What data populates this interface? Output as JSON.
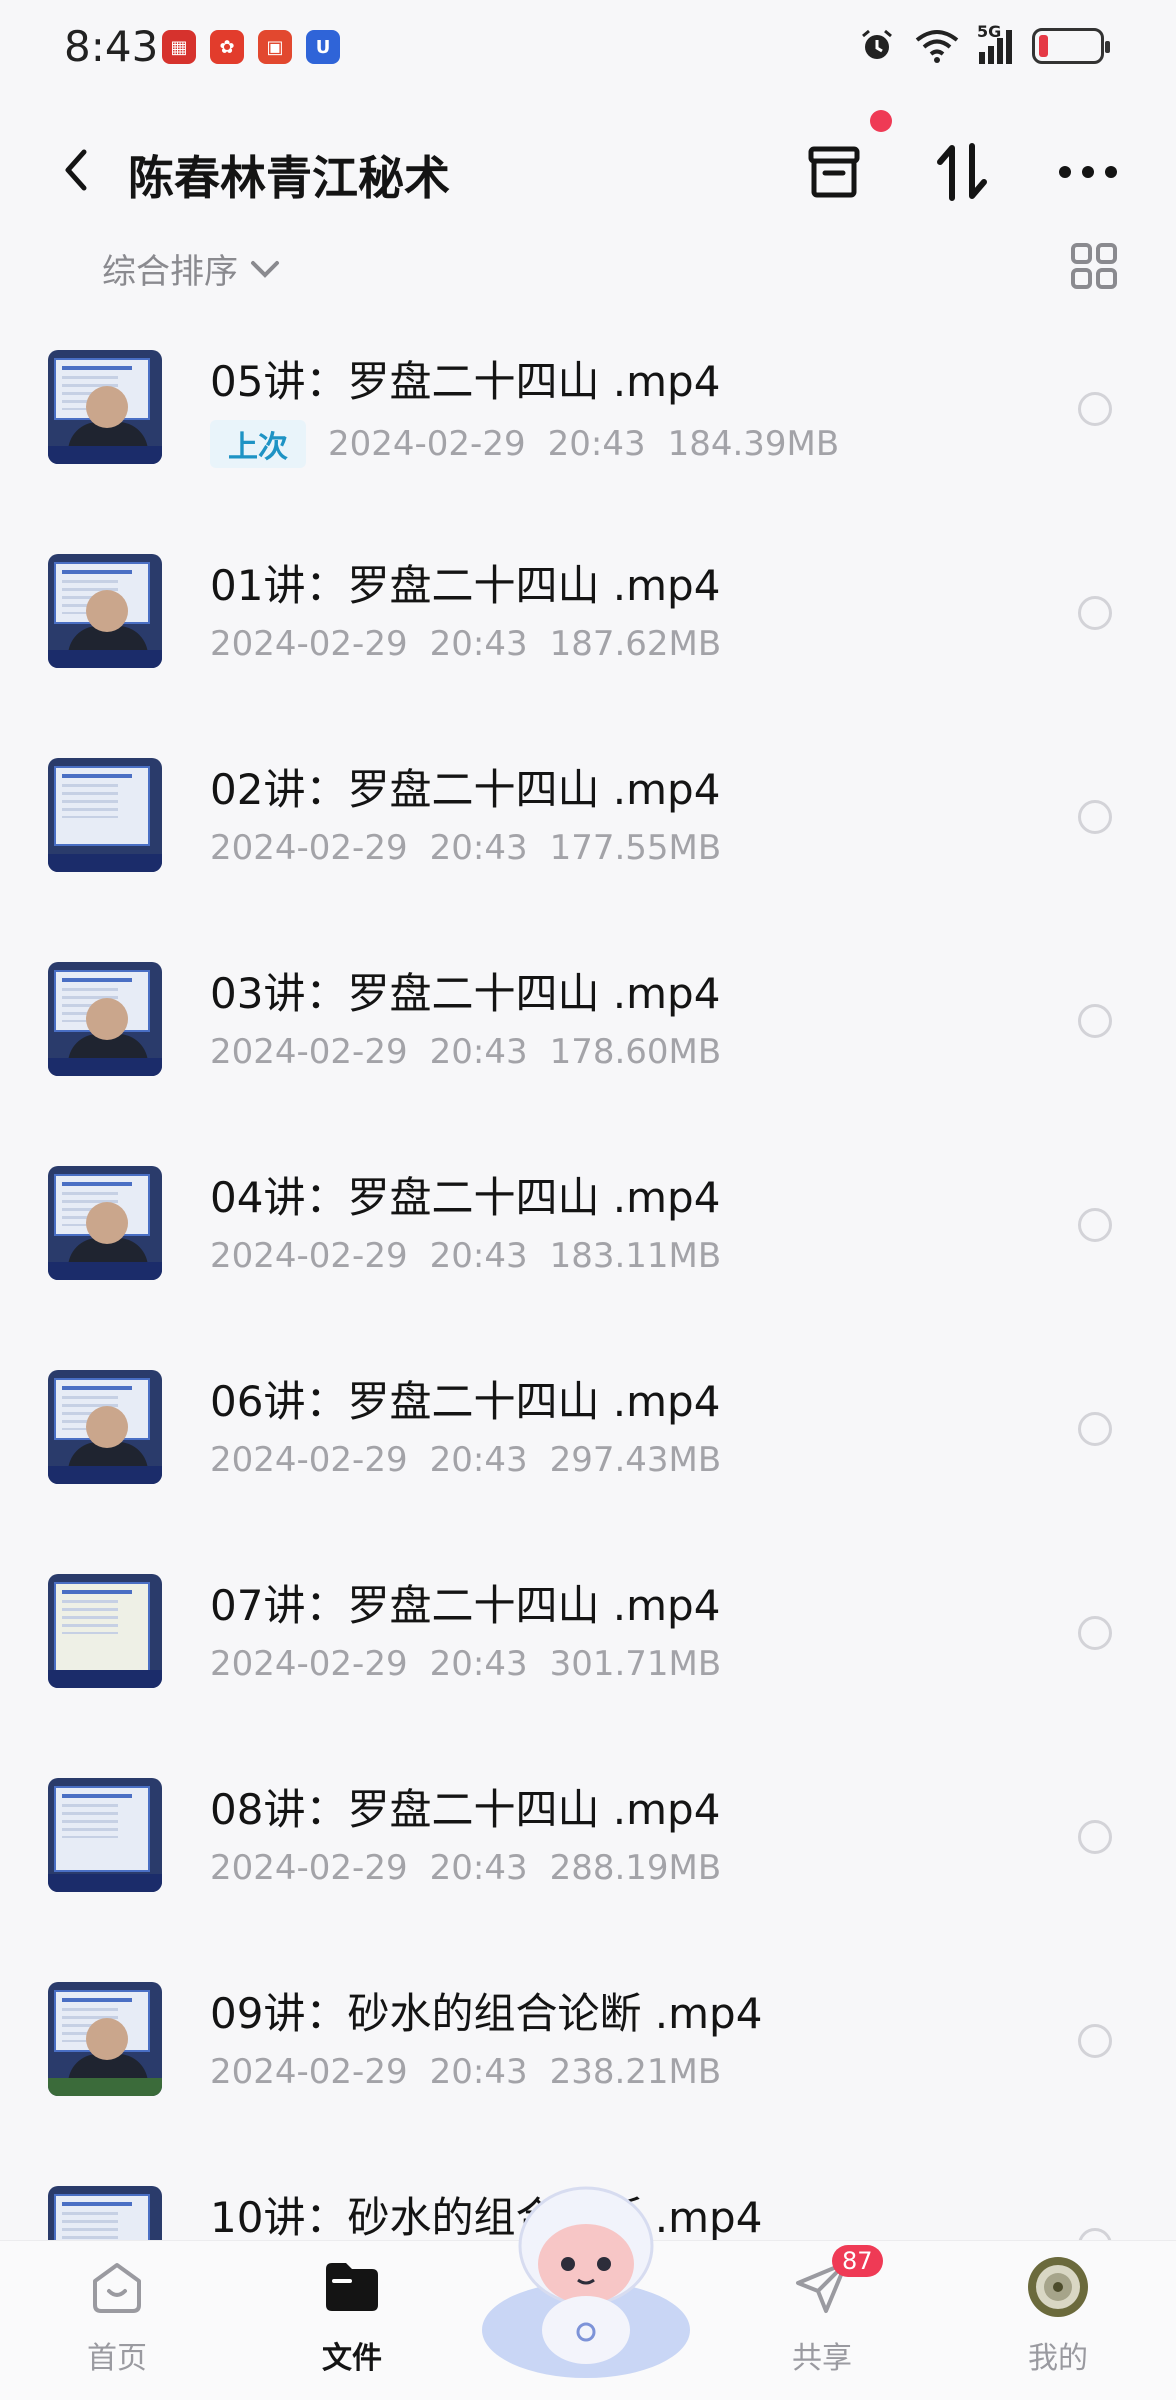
{
  "status_bar": {
    "time": "8:43",
    "network": "5G"
  },
  "header": {
    "title": "陈春林青江秘术",
    "back_icon": "chevron-left-icon",
    "archive_icon": "archive-box-icon",
    "sort_icon": "sort-arrows-icon",
    "more_icon": "more-horizontal-icon"
  },
  "sort": {
    "label": "综合排序"
  },
  "files": [
    {
      "name": "05讲：罗盘二十四山 .mp4",
      "tag": "上次",
      "date": "2024-02-29",
      "time": "20:43",
      "size": "184.39MB"
    },
    {
      "name": "01讲：罗盘二十四山 .mp4",
      "tag": "",
      "date": "2024-02-29",
      "time": "20:43",
      "size": "187.62MB"
    },
    {
      "name": "02讲：罗盘二十四山 .mp4",
      "tag": "",
      "date": "2024-02-29",
      "time": "20:43",
      "size": "177.55MB"
    },
    {
      "name": "03讲：罗盘二十四山 .mp4",
      "tag": "",
      "date": "2024-02-29",
      "time": "20:43",
      "size": "178.60MB"
    },
    {
      "name": "04讲：罗盘二十四山 .mp4",
      "tag": "",
      "date": "2024-02-29",
      "time": "20:43",
      "size": "183.11MB"
    },
    {
      "name": "06讲：罗盘二十四山 .mp4",
      "tag": "",
      "date": "2024-02-29",
      "time": "20:43",
      "size": "297.43MB"
    },
    {
      "name": "07讲：罗盘二十四山 .mp4",
      "tag": "",
      "date": "2024-02-29",
      "time": "20:43",
      "size": "301.71MB"
    },
    {
      "name": "08讲：罗盘二十四山 .mp4",
      "tag": "",
      "date": "2024-02-29",
      "time": "20:43",
      "size": "288.19MB"
    },
    {
      "name": "09讲：砂水的组合论断 .mp4",
      "tag": "",
      "date": "2024-02-29",
      "time": "20:43",
      "size": "238.21MB"
    },
    {
      "name": "10讲：砂水的组合论断 .mp4",
      "tag": "",
      "date": "",
      "time": "",
      "size": ""
    }
  ],
  "bottom_nav": {
    "home": "首页",
    "files": "文件",
    "share": "共享",
    "share_badge": "87",
    "me": "我的"
  },
  "colors": {
    "accent_red": "#ef3a55",
    "tag_blue": "#1e93c4",
    "meta_gray": "#a3a3a8"
  }
}
